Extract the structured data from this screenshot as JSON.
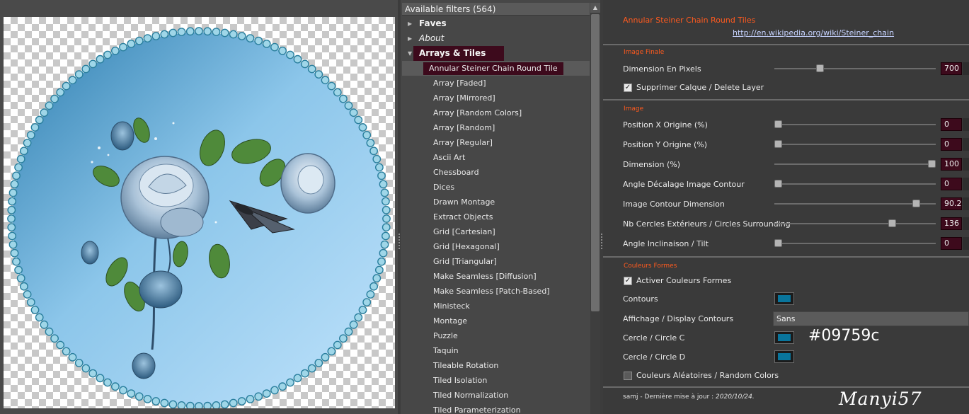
{
  "filters": {
    "header": "Available filters (564)",
    "categories": [
      {
        "label": "Faves"
      },
      {
        "label": "About"
      },
      {
        "label": "Arrays & Tiles"
      }
    ],
    "items": [
      "Annular Steiner Chain Round Tile",
      "Array [Faded]",
      "Array [Mirrored]",
      "Array [Random Colors]",
      "Array [Random]",
      "Array [Regular]",
      "Ascii Art",
      "Chessboard",
      "Dices",
      "Drawn Montage",
      "Extract Objects",
      "Grid [Cartesian]",
      "Grid [Hexagonal]",
      "Grid [Triangular]",
      "Make Seamless [Diffusion]",
      "Make Seamless [Patch-Based]",
      "Ministeck",
      "Montage",
      "Puzzle",
      "Taquin",
      "Tileable Rotation",
      "Tiled Isolation",
      "Tiled Normalization",
      "Tiled Parameterization"
    ],
    "selected_item": "Annular Steiner Chain Round Tile"
  },
  "params": {
    "title": "Annular Steiner Chain Round Tiles",
    "link": "http://en.wikipedia.org/wiki/Steiner_chain",
    "section_image_finale": "Image Finale",
    "dimension_pixels": {
      "label": "Dimension En Pixels",
      "value": "700",
      "fraction": 0.27
    },
    "delete_layer": {
      "label": "Supprimer Calque / Delete Layer",
      "checked": true
    },
    "section_image": "Image",
    "position_x": {
      "label": "Position X Origine (%)",
      "value": "0",
      "fraction": 0.0
    },
    "position_y": {
      "label": "Position Y Origine (%)",
      "value": "0",
      "fraction": 0.0
    },
    "dimension_pct": {
      "label": "Dimension (%)",
      "value": "100",
      "fraction": 1.0
    },
    "angle_offset": {
      "label": "Angle Décalage Image Contour",
      "value": "0",
      "fraction": 0.0
    },
    "contour_dimension": {
      "label": "Image Contour Dimension",
      "value": "90.2",
      "fraction": 0.9
    },
    "circles_surrounding": {
      "label": "Nb Cercles Extérieurs / Circles Surrounding",
      "value": "136",
      "fraction": 0.74
    },
    "tilt": {
      "label": "Angle Inclinaison / Tilt",
      "value": "0",
      "fraction": 0.0
    },
    "section_colors": "Couleurs Formes",
    "activate_colors": {
      "label": "Activer Couleurs Formes",
      "checked": true
    },
    "contours_label": "Contours",
    "display_contours": {
      "label": "Affichage / Display Contours",
      "value": "Sans"
    },
    "circle_c_label": "Cercle / Circle C",
    "circle_c_hex": "#09759c",
    "circle_d_label": "Cercle / Circle D",
    "random_colors": {
      "label": "Couleurs Aléatoires / Random Colors",
      "checked": false
    },
    "footer_author": "samj - Dernière mise à jour :",
    "footer_date": "2020/10/24.",
    "signature": "Manyi57"
  },
  "colors": {
    "swatch": "#09759c",
    "accent": "#ff5a1e",
    "selection": "#3d0a1c"
  }
}
